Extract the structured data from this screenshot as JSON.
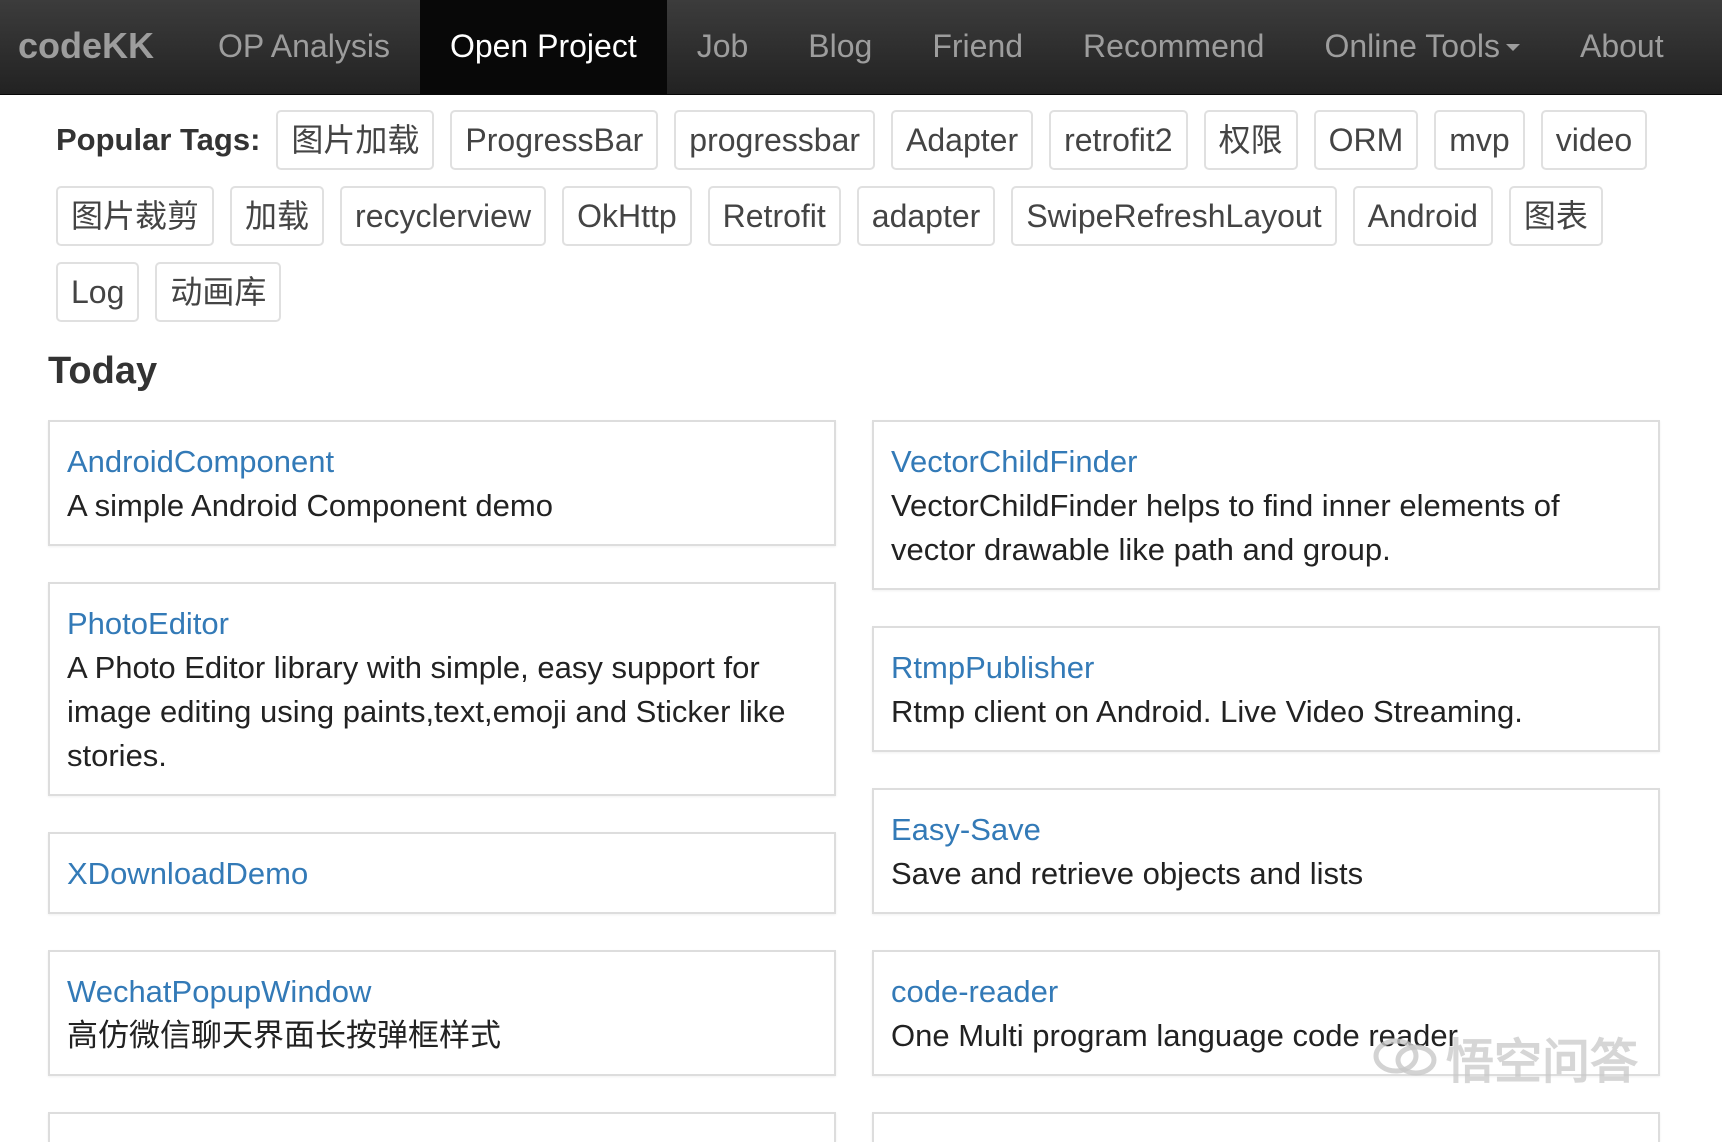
{
  "navbar": {
    "brand": "codeKK",
    "items": [
      {
        "label": "OP Analysis",
        "active": false
      },
      {
        "label": "Open Project",
        "active": true
      },
      {
        "label": "Job",
        "active": false
      },
      {
        "label": "Blog",
        "active": false
      },
      {
        "label": "Friend",
        "active": false
      },
      {
        "label": "Recommend",
        "active": false
      },
      {
        "label": "Online Tools",
        "active": false,
        "dropdown": true
      },
      {
        "label": "About",
        "active": false
      }
    ]
  },
  "tags": {
    "label": "Popular Tags:",
    "rows": [
      [
        "图片加载",
        "ProgressBar",
        "progressbar",
        "Adapter",
        "retrofit2",
        "权限",
        "ORM",
        "mvp",
        "video"
      ],
      [
        "图片裁剪",
        "加载",
        "recyclerview",
        "OkHttp",
        "Retrofit",
        "adapter",
        "SwipeRefreshLayout",
        "Android",
        "图表"
      ],
      [
        "Log",
        "动画库"
      ]
    ]
  },
  "today": {
    "title": "Today",
    "left": [
      {
        "name": "AndroidComponent",
        "desc": "A simple Android Component demo"
      },
      {
        "name": "PhotoEditor",
        "desc": "A Photo Editor library with simple, easy support for image editing using paints,text,emoji and Sticker like stories."
      },
      {
        "name": "XDownloadDemo",
        "desc": ""
      },
      {
        "name": "WechatPopupWindow",
        "desc": "高仿微信聊天界面长按弹框样式"
      }
    ],
    "right": [
      {
        "name": "VectorChildFinder",
        "desc": "VectorChildFinder helps to find inner elements of vector drawable like path and group."
      },
      {
        "name": "RtmpPublisher",
        "desc": "Rtmp client on Android. Live Video Streaming."
      },
      {
        "name": "Easy-Save",
        "desc": "Save and retrieve objects and lists"
      },
      {
        "name": "code-reader",
        "desc": "One Multi program language code reader"
      }
    ]
  },
  "watermark": "悟空问答",
  "colors": {
    "navbar_bg": "#222222",
    "nav_active_bg": "#080808",
    "nav_text": "#9d9d9d",
    "link": "#337ab7"
  }
}
